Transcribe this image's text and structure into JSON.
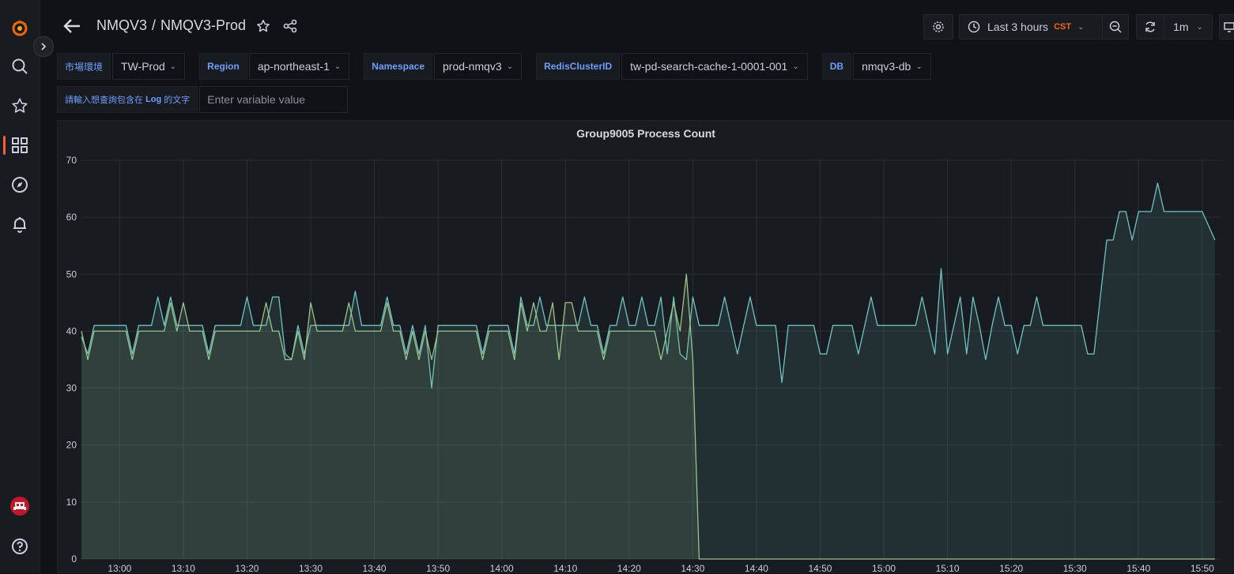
{
  "header": {
    "folder": "NMQV3",
    "separator": "/",
    "dashboard_title": "NMQV3-Prod",
    "time_range": "Last 3 hours",
    "timezone": "CST",
    "refresh_interval": "1m"
  },
  "variables": [
    {
      "label": "市場環境",
      "value": "TW-Prod"
    },
    {
      "label": "Region",
      "value": "ap-northeast-1"
    },
    {
      "label": "Namespace",
      "value": "prod-nmqv3"
    },
    {
      "label": "RedisClusterID",
      "value": "tw-pd-search-cache-1-0001-001"
    },
    {
      "label": "DB",
      "value": "nmqv3-db"
    }
  ],
  "log_filter": {
    "label_prefix": "請輸入想查詢包含在",
    "label_keyword": "Log",
    "label_suffix": "的文字",
    "placeholder": "Enter variable value"
  },
  "colors": {
    "brand": "#f46800",
    "accent_blue": "#6e9fff",
    "series_teal": "#6fc3c4",
    "series_green": "#9ac48a"
  },
  "sidebar_icons": [
    "grafana-logo-icon",
    "search-icon",
    "starred-icon",
    "dashboards-icon",
    "explore-icon",
    "alerting-icon",
    "user-avatar-icon",
    "help-icon"
  ],
  "chart_data": {
    "type": "area",
    "title": "Group9005 Process Count",
    "ylim": [
      0,
      70
    ],
    "yticks": [
      0,
      10,
      20,
      30,
      40,
      50,
      60,
      70
    ],
    "x_range": [
      "12:54",
      "15:53"
    ],
    "xticks": [
      "13:00",
      "13:10",
      "13:20",
      "13:30",
      "13:40",
      "13:50",
      "14:00",
      "14:10",
      "14:20",
      "14:30",
      "14:40",
      "14:50",
      "15:00",
      "15:10",
      "15:20",
      "15:30",
      "15:40",
      "15:50"
    ],
    "grid": true,
    "series": [
      {
        "color": "#6fc3c4",
        "points": [
          [
            "12:54",
            39
          ],
          [
            "12:55",
            36
          ],
          [
            "12:56",
            41
          ],
          [
            "12:57",
            41
          ],
          [
            "12:58",
            41
          ],
          [
            "12:59",
            41
          ],
          [
            "13:00",
            41
          ],
          [
            "13:01",
            41
          ],
          [
            "13:02",
            36
          ],
          [
            "13:03",
            41
          ],
          [
            "13:04",
            41
          ],
          [
            "13:05",
            41
          ],
          [
            "13:06",
            46
          ],
          [
            "13:07",
            41
          ],
          [
            "13:08",
            46
          ],
          [
            "13:09",
            41
          ],
          [
            "13:10",
            41
          ],
          [
            "13:11",
            41
          ],
          [
            "13:12",
            41
          ],
          [
            "13:13",
            41
          ],
          [
            "13:14",
            36
          ],
          [
            "13:15",
            41
          ],
          [
            "13:16",
            41
          ],
          [
            "13:17",
            41
          ],
          [
            "13:18",
            41
          ],
          [
            "13:19",
            41
          ],
          [
            "13:20",
            46
          ],
          [
            "13:21",
            41
          ],
          [
            "13:22",
            41
          ],
          [
            "13:23",
            41
          ],
          [
            "13:24",
            46
          ],
          [
            "13:25",
            46
          ],
          [
            "13:26",
            36
          ],
          [
            "13:27",
            35
          ],
          [
            "13:28",
            41
          ],
          [
            "13:29",
            36
          ],
          [
            "13:30",
            41
          ],
          [
            "13:31",
            41
          ],
          [
            "13:32",
            41
          ],
          [
            "13:33",
            41
          ],
          [
            "13:34",
            41
          ],
          [
            "13:35",
            41
          ],
          [
            "13:36",
            41
          ],
          [
            "13:37",
            47
          ],
          [
            "13:38",
            41
          ],
          [
            "13:39",
            41
          ],
          [
            "13:40",
            41
          ],
          [
            "13:41",
            41
          ],
          [
            "13:42",
            46
          ],
          [
            "13:43",
            41
          ],
          [
            "13:44",
            41
          ],
          [
            "13:45",
            36
          ],
          [
            "13:46",
            41
          ],
          [
            "13:47",
            36
          ],
          [
            "13:48",
            41
          ],
          [
            "13:49",
            30
          ],
          [
            "13:50",
            41
          ],
          [
            "13:51",
            41
          ],
          [
            "13:52",
            41
          ],
          [
            "13:53",
            41
          ],
          [
            "13:54",
            41
          ],
          [
            "13:55",
            41
          ],
          [
            "13:56",
            41
          ],
          [
            "13:57",
            36
          ],
          [
            "13:58",
            41
          ],
          [
            "13:59",
            41
          ],
          [
            "14:00",
            41
          ],
          [
            "14:01",
            41
          ],
          [
            "14:02",
            36
          ],
          [
            "14:03",
            46
          ],
          [
            "14:04",
            41
          ],
          [
            "14:05",
            41
          ],
          [
            "14:06",
            46
          ],
          [
            "14:07",
            41
          ],
          [
            "14:08",
            41
          ],
          [
            "14:09",
            41
          ],
          [
            "14:10",
            41
          ],
          [
            "14:11",
            41
          ],
          [
            "14:12",
            41
          ],
          [
            "14:13",
            46
          ],
          [
            "14:14",
            41
          ],
          [
            "14:15",
            41
          ],
          [
            "14:16",
            36
          ],
          [
            "14:17",
            41
          ],
          [
            "14:18",
            41
          ],
          [
            "14:19",
            46
          ],
          [
            "14:20",
            41
          ],
          [
            "14:21",
            41
          ],
          [
            "14:22",
            46
          ],
          [
            "14:23",
            41
          ],
          [
            "14:24",
            41
          ],
          [
            "14:25",
            46
          ],
          [
            "14:26",
            36
          ],
          [
            "14:27",
            46
          ],
          [
            "14:28",
            36
          ],
          [
            "14:29",
            35
          ],
          [
            "14:30",
            46
          ],
          [
            "14:31",
            41
          ],
          [
            "14:32",
            41
          ],
          [
            "14:33",
            41
          ],
          [
            "14:34",
            41
          ],
          [
            "14:35",
            46
          ],
          [
            "14:36",
            41
          ],
          [
            "14:37",
            36
          ],
          [
            "14:38",
            41
          ],
          [
            "14:39",
            46
          ],
          [
            "14:40",
            41
          ],
          [
            "14:41",
            41
          ],
          [
            "14:42",
            41
          ],
          [
            "14:43",
            41
          ],
          [
            "14:44",
            31
          ],
          [
            "14:45",
            41
          ],
          [
            "14:46",
            41
          ],
          [
            "14:47",
            41
          ],
          [
            "14:48",
            41
          ],
          [
            "14:49",
            41
          ],
          [
            "14:50",
            36
          ],
          [
            "14:51",
            36
          ],
          [
            "14:52",
            41
          ],
          [
            "14:53",
            41
          ],
          [
            "14:54",
            41
          ],
          [
            "14:55",
            41
          ],
          [
            "14:56",
            36
          ],
          [
            "14:57",
            41
          ],
          [
            "14:58",
            46
          ],
          [
            "14:59",
            41
          ],
          [
            "15:00",
            41
          ],
          [
            "15:01",
            41
          ],
          [
            "15:02",
            41
          ],
          [
            "15:03",
            41
          ],
          [
            "15:04",
            41
          ],
          [
            "15:05",
            41
          ],
          [
            "15:06",
            46
          ],
          [
            "15:07",
            41
          ],
          [
            "15:08",
            36
          ],
          [
            "15:09",
            51
          ],
          [
            "15:10",
            36
          ],
          [
            "15:11",
            41
          ],
          [
            "15:12",
            46
          ],
          [
            "15:13",
            36
          ],
          [
            "15:14",
            46
          ],
          [
            "15:15",
            41
          ],
          [
            "15:16",
            35
          ],
          [
            "15:17",
            41
          ],
          [
            "15:18",
            46
          ],
          [
            "15:19",
            41
          ],
          [
            "15:20",
            41
          ],
          [
            "15:21",
            36
          ],
          [
            "15:22",
            41
          ],
          [
            "15:23",
            41
          ],
          [
            "15:24",
            46
          ],
          [
            "15:25",
            41
          ],
          [
            "15:26",
            41
          ],
          [
            "15:27",
            41
          ],
          [
            "15:28",
            41
          ],
          [
            "15:29",
            41
          ],
          [
            "15:30",
            41
          ],
          [
            "15:31",
            41
          ],
          [
            "15:32",
            36
          ],
          [
            "15:33",
            36
          ],
          [
            "15:34",
            46
          ],
          [
            "15:35",
            56
          ],
          [
            "15:36",
            56
          ],
          [
            "15:37",
            61
          ],
          [
            "15:38",
            61
          ],
          [
            "15:39",
            56
          ],
          [
            "15:40",
            61
          ],
          [
            "15:41",
            61
          ],
          [
            "15:42",
            61
          ],
          [
            "15:43",
            66
          ],
          [
            "15:44",
            61
          ],
          [
            "15:45",
            61
          ],
          [
            "15:46",
            61
          ],
          [
            "15:47",
            61
          ],
          [
            "15:48",
            61
          ],
          [
            "15:49",
            61
          ],
          [
            "15:50",
            61
          ],
          [
            "15:52",
            56
          ]
        ]
      },
      {
        "color": "#9ac48a",
        "points": [
          [
            "12:54",
            40
          ],
          [
            "12:55",
            35
          ],
          [
            "12:56",
            40
          ],
          [
            "12:57",
            40
          ],
          [
            "12:58",
            40
          ],
          [
            "12:59",
            40
          ],
          [
            "13:00",
            40
          ],
          [
            "13:01",
            40
          ],
          [
            "13:02",
            35
          ],
          [
            "13:03",
            40
          ],
          [
            "13:04",
            40
          ],
          [
            "13:05",
            40
          ],
          [
            "13:06",
            40
          ],
          [
            "13:07",
            40
          ],
          [
            "13:08",
            45
          ],
          [
            "13:09",
            40
          ],
          [
            "13:10",
            45
          ],
          [
            "13:11",
            40
          ],
          [
            "13:12",
            40
          ],
          [
            "13:13",
            40
          ],
          [
            "13:14",
            35
          ],
          [
            "13:15",
            40
          ],
          [
            "13:16",
            40
          ],
          [
            "13:17",
            40
          ],
          [
            "13:18",
            40
          ],
          [
            "13:19",
            40
          ],
          [
            "13:20",
            40
          ],
          [
            "13:21",
            40
          ],
          [
            "13:22",
            40
          ],
          [
            "13:23",
            45
          ],
          [
            "13:24",
            40
          ],
          [
            "13:25",
            40
          ],
          [
            "13:26",
            35
          ],
          [
            "13:27",
            35
          ],
          [
            "13:28",
            40
          ],
          [
            "13:29",
            35
          ],
          [
            "13:30",
            45
          ],
          [
            "13:31",
            40
          ],
          [
            "13:32",
            40
          ],
          [
            "13:33",
            40
          ],
          [
            "13:34",
            40
          ],
          [
            "13:35",
            40
          ],
          [
            "13:36",
            45
          ],
          [
            "13:37",
            40
          ],
          [
            "13:38",
            40
          ],
          [
            "13:39",
            40
          ],
          [
            "13:40",
            40
          ],
          [
            "13:41",
            40
          ],
          [
            "13:42",
            45
          ],
          [
            "13:43",
            40
          ],
          [
            "13:44",
            40
          ],
          [
            "13:45",
            35
          ],
          [
            "13:46",
            40
          ],
          [
            "13:47",
            35
          ],
          [
            "13:48",
            40
          ],
          [
            "13:49",
            35
          ],
          [
            "13:50",
            40
          ],
          [
            "13:51",
            40
          ],
          [
            "13:52",
            40
          ],
          [
            "13:53",
            40
          ],
          [
            "13:54",
            40
          ],
          [
            "13:55",
            40
          ],
          [
            "13:56",
            40
          ],
          [
            "13:57",
            35
          ],
          [
            "13:58",
            40
          ],
          [
            "13:59",
            40
          ],
          [
            "14:00",
            40
          ],
          [
            "14:01",
            40
          ],
          [
            "14:02",
            35
          ],
          [
            "14:03",
            45
          ],
          [
            "14:04",
            40
          ],
          [
            "14:05",
            45
          ],
          [
            "14:06",
            40
          ],
          [
            "14:07",
            40
          ],
          [
            "14:08",
            45
          ],
          [
            "14:09",
            35
          ],
          [
            "14:10",
            45
          ],
          [
            "14:11",
            45
          ],
          [
            "14:12",
            40
          ],
          [
            "14:13",
            40
          ],
          [
            "14:14",
            40
          ],
          [
            "14:15",
            40
          ],
          [
            "14:16",
            35
          ],
          [
            "14:17",
            40
          ],
          [
            "14:18",
            40
          ],
          [
            "14:19",
            40
          ],
          [
            "14:20",
            40
          ],
          [
            "14:21",
            40
          ],
          [
            "14:22",
            40
          ],
          [
            "14:23",
            40
          ],
          [
            "14:24",
            40
          ],
          [
            "14:25",
            35
          ],
          [
            "14:26",
            40
          ],
          [
            "14:27",
            45
          ],
          [
            "14:28",
            40
          ],
          [
            "14:29",
            50
          ],
          [
            "14:30",
            35
          ],
          [
            "14:31",
            0
          ],
          [
            "14:50",
            0
          ],
          [
            "15:10",
            0
          ],
          [
            "15:30",
            0
          ],
          [
            "15:52",
            0
          ]
        ]
      }
    ]
  }
}
